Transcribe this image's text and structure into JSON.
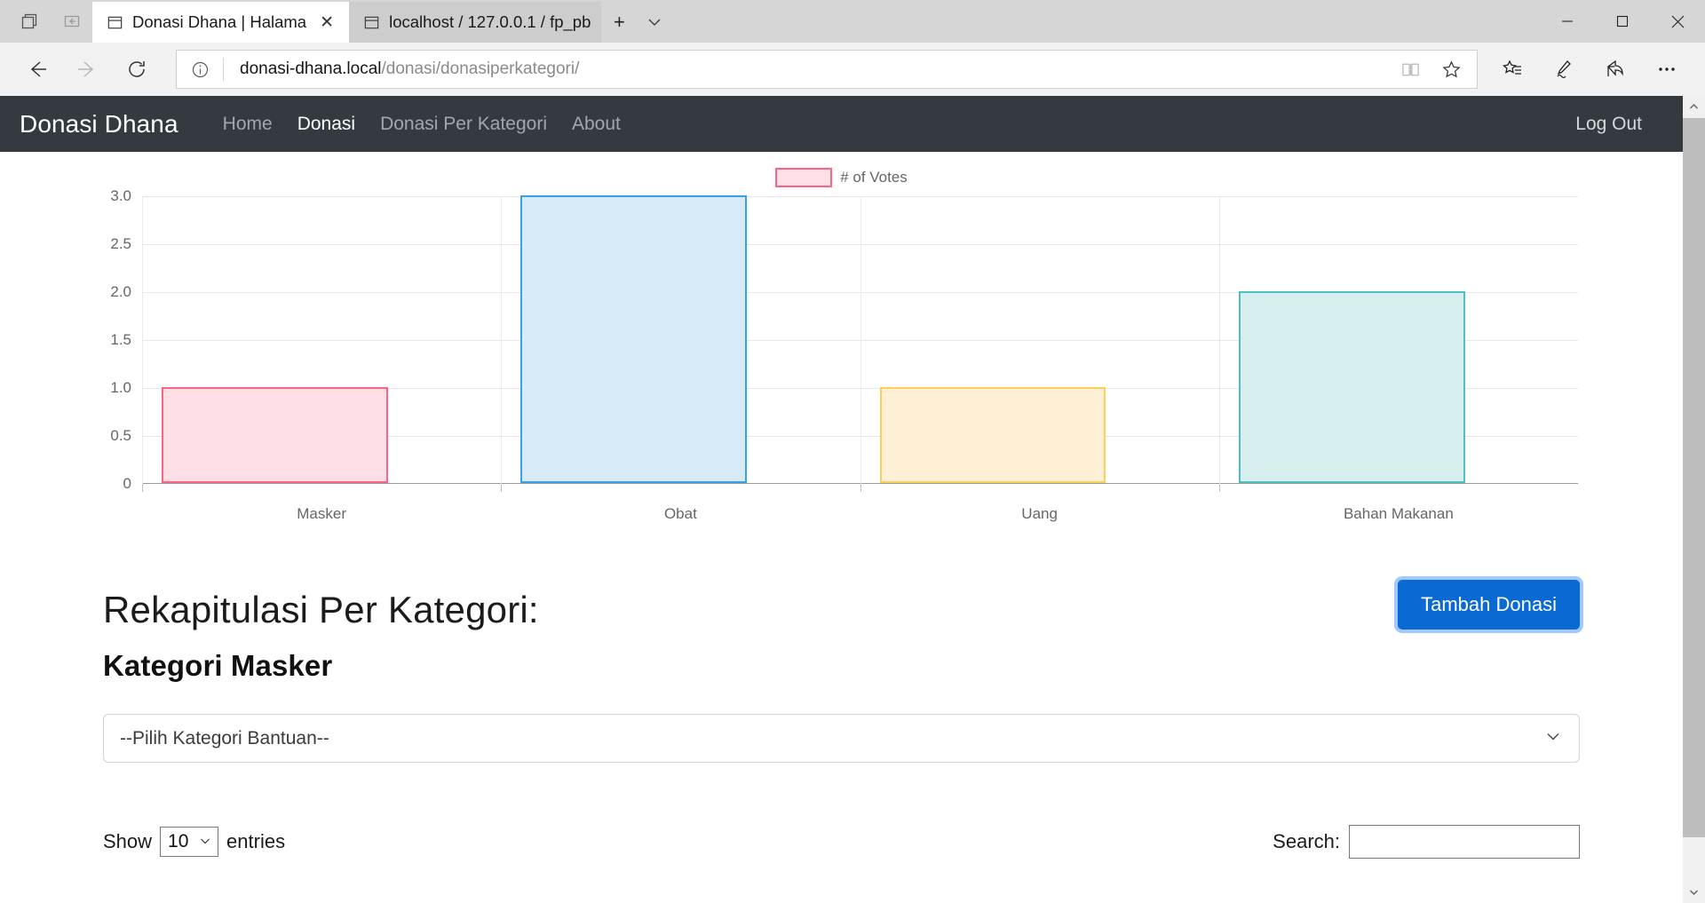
{
  "browser": {
    "tabs": [
      {
        "title": "Donasi Dhana | Halama",
        "active": true,
        "close_label": "✕"
      },
      {
        "title": "localhost / 127.0.0.1 / fp_pb",
        "active": false,
        "close_label": ""
      }
    ],
    "new_tab_label": "+",
    "tab_menu_label": "⌵",
    "window_controls": {
      "minimize": "—",
      "maximize": "☐",
      "close": "✕"
    },
    "left_buttons": [
      {
        "name": "tab-preview-icon"
      },
      {
        "name": "set-tabs-aside-icon"
      }
    ],
    "nav": {
      "back_label": "←",
      "forward_label": "→",
      "refresh_label": "↻"
    },
    "url": {
      "domain": "donasi-dhana.local",
      "path": "/donasi/donasiperkategori/",
      "info_icon": "ⓘ",
      "reading_view_icon": "reading-view-icon",
      "favorite_icon": "☆"
    },
    "toolbar_icons": [
      {
        "name": "favorites-hub-icon"
      },
      {
        "name": "web-notes-icon"
      },
      {
        "name": "share-icon"
      },
      {
        "name": "more-settings-icon",
        "label": "⋯"
      }
    ]
  },
  "site": {
    "brand": "Donasi Dhana",
    "nav_items": [
      {
        "label": "Home",
        "active": false
      },
      {
        "label": "Donasi",
        "active": true
      },
      {
        "label": "Donasi Per Kategori",
        "active": false
      },
      {
        "label": "About",
        "active": false
      }
    ],
    "logout_label": "Log Out"
  },
  "chart_data": {
    "type": "bar",
    "title": "",
    "categories": [
      "Masker",
      "Obat",
      "Uang",
      "Bahan Makanan"
    ],
    "values": [
      1,
      3,
      1,
      2
    ],
    "legend": [
      {
        "label": "# of Votes",
        "fill": "#ffe0e6",
        "border": "#ff6384"
      }
    ],
    "legend_position": "top",
    "xlabel": "",
    "ylabel": "",
    "ylim": [
      0,
      3
    ],
    "yticks": [
      "0",
      "0.5",
      "1.0",
      "1.5",
      "2.0",
      "2.5",
      "3.0"
    ],
    "ytick_values": [
      0,
      0.5,
      1.0,
      1.5,
      2.0,
      2.5,
      3.0
    ],
    "grid": true,
    "bar_colors": [
      {
        "fill": "#ffdfe6",
        "border": "#ff6384"
      },
      {
        "fill": "#d7eaf8",
        "border": "#36a2eb"
      },
      {
        "fill": "#fdf0d5",
        "border": "#ffce56"
      },
      {
        "fill": "#d8efef",
        "border": "#4bc0c0"
      }
    ]
  },
  "main": {
    "page_title": "Rekapitulasi Per Kategori:",
    "subtitle": "Kategori Masker",
    "add_button": "Tambah Donasi",
    "category_select": {
      "value": "--Pilih Kategori Bantuan--",
      "chevron": "⌄"
    },
    "table_controls": {
      "show_label": "Show",
      "entries_label": "entries",
      "page_length": "10",
      "page_length_chevron": "⌄",
      "search_label": "Search:",
      "search_value": "",
      "search_placeholder": ""
    }
  },
  "scrollbar": {
    "up": "∧",
    "down": "∨"
  }
}
